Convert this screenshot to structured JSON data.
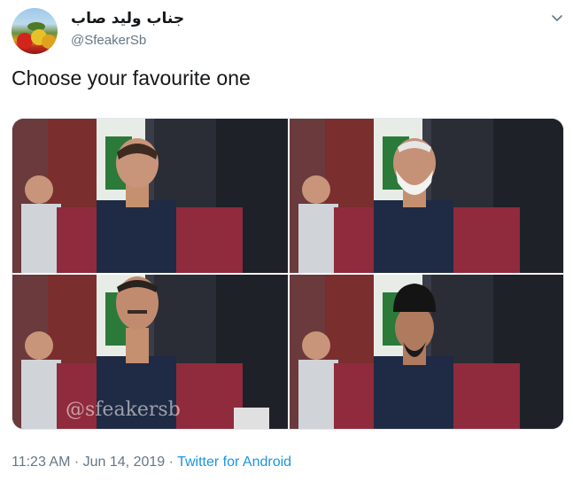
{
  "author": {
    "display_name": "جناب ولید صاب",
    "handle": "@SfeakerSb"
  },
  "tweet": {
    "text": "Choose your favourite one"
  },
  "media": {
    "watermark": "@sfeakersb"
  },
  "meta": {
    "time": "11:23 AM",
    "sep1": " · ",
    "date": "Jun 14, 2019",
    "sep2": " · ",
    "source": "Twitter for Android"
  },
  "colors": {
    "text": "#14171a",
    "secondary": "#657786",
    "link": "#1b95e0"
  }
}
